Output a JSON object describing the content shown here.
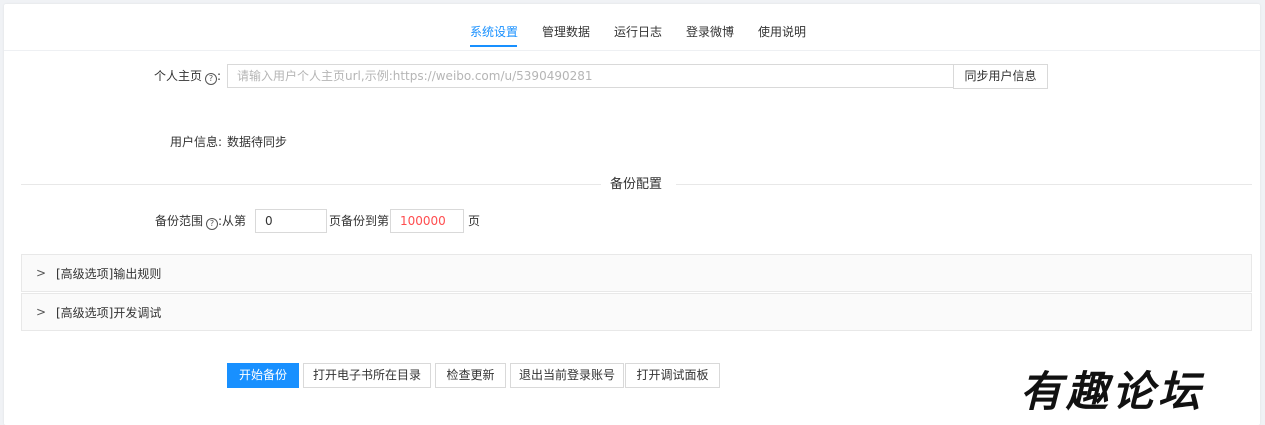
{
  "tabs": [
    {
      "label": "系统设置",
      "active": true
    },
    {
      "label": "管理数据",
      "active": false
    },
    {
      "label": "运行日志",
      "active": false
    },
    {
      "label": "登录微博",
      "active": false
    },
    {
      "label": "使用说明",
      "active": false
    }
  ],
  "profile": {
    "label": "个人主页",
    "placeholder": "请输入用户个人主页url,示例:https://weibo.com/u/5390490281",
    "value": "",
    "sync_button": "同步用户信息"
  },
  "user_info": {
    "label": "用户信息:",
    "value": "数据待同步"
  },
  "backup_config": {
    "title": "备份配置",
    "range_label": "备份范围",
    "from_text": ":从第",
    "from_value": "0",
    "mid_text": "页备份到第",
    "to_value": "100000",
    "to_value_color": "#ff4d4f",
    "end_text": "页"
  },
  "advanced": [
    {
      "title": "[高级选项]输出规则"
    },
    {
      "title": "[高级选项]开发调试"
    }
  ],
  "actions": {
    "start": "开始备份",
    "open_dir": "打开电子书所在目录",
    "check_update": "检查更新",
    "logout": "退出当前登录账号",
    "open_debug": "打开调试面板"
  },
  "colors": {
    "accent": "#1890ff",
    "background": "#f0f2f5"
  },
  "watermark": "有趣论坛"
}
